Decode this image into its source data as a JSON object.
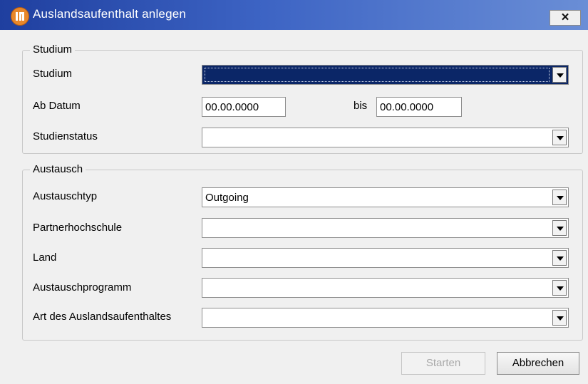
{
  "window": {
    "title": "Auslandsaufenthalt anlegen",
    "close_label": "×"
  },
  "studium": {
    "group_label": "Studium",
    "studium_label": "Studium",
    "studium_value": "",
    "ab_datum_label": "Ab Datum",
    "ab_datum_value": "00.00.0000",
    "bis_label": "bis",
    "bis_value": "00.00.0000",
    "studienstatus_label": "Studienstatus",
    "studienstatus_value": ""
  },
  "austausch": {
    "group_label": "Austausch",
    "austauschtyp_label": "Austauschtyp",
    "austauschtyp_value": "Outgoing",
    "partnerhochschule_label": "Partnerhochschule",
    "partnerhochschule_value": "",
    "land_label": "Land",
    "land_value": "",
    "austauschprogramm_label": "Austauschprogramm",
    "austauschprogramm_value": "",
    "art_label": "Art des Auslandsaufenthaltes",
    "art_value": ""
  },
  "buttons": {
    "start_label": "Starten",
    "cancel_label": "Abbrechen"
  },
  "icons": {
    "app": "app-logo-icon",
    "close": "close-icon",
    "dropdown": "chevron-down-icon"
  }
}
